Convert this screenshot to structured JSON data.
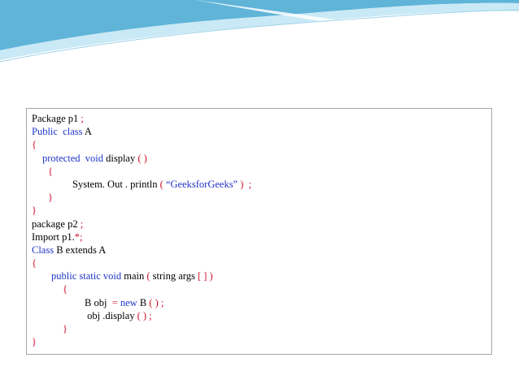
{
  "colors": {
    "keyword": "#1f36c8",
    "punctuation": "#d0102a",
    "text": "#000000",
    "border": "#a6a6a6",
    "banner_dark": "#5fb4d8",
    "banner_light": "#c9e9f6"
  },
  "code": {
    "l1": {
      "a": "Package p1 ",
      "b": ";"
    },
    "l2": {
      "a": "Public  class",
      "b": " A"
    },
    "l3": {
      "a": "{"
    },
    "l4": {
      "a": "protected  void",
      "b": " display ",
      "c": "( )"
    },
    "l5": {
      "a": "{"
    },
    "l6": {
      "a": "System. Out . println ",
      "b": "( ",
      "c": "“GeeksforGeeks” ",
      "d": ")  ;"
    },
    "l7": {
      "a": "}"
    },
    "l8": {
      "a": "}"
    },
    "l9": {
      "a": "package p2 ",
      "b": ";"
    },
    "l10": {
      "a": "Import p1.",
      "b": "*;"
    },
    "l11": {
      "a": "Class",
      "b": " B extends A"
    },
    "l12": {
      "a": "{"
    },
    "l13": {
      "a": "public static void",
      "b": " main ",
      "c": "( ",
      "d": "string args ",
      "e": "[ ] )"
    },
    "l14": {
      "a": "{"
    },
    "l15": {
      "a": "B obj  ",
      "b": "= ",
      "c": "new",
      "d": " B ",
      "e": "( ) ;"
    },
    "l16": {
      "a": " obj .display ",
      "b": "( ) ;"
    },
    "l17": {
      "a": "}"
    },
    "l18": {
      "a": "}"
    }
  }
}
